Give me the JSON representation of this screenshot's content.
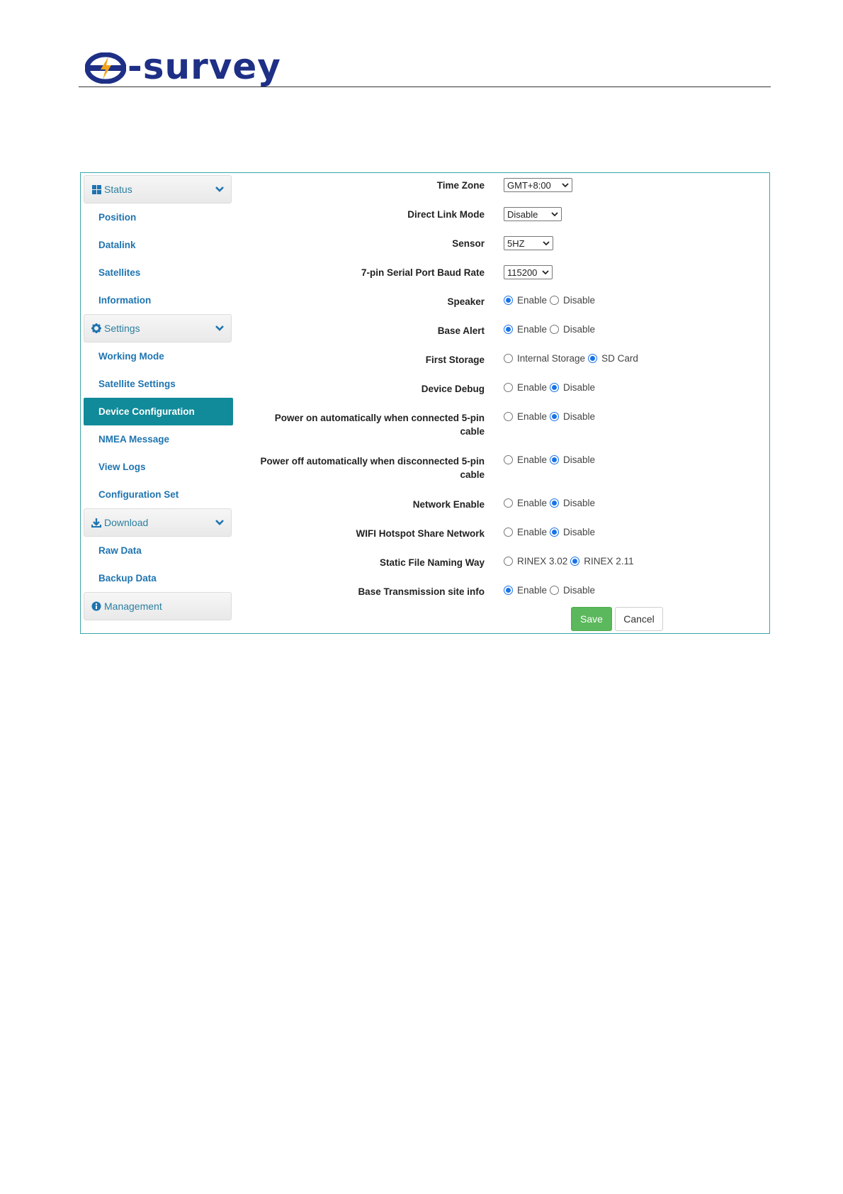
{
  "brand": {
    "name": "-survey",
    "color": "#1e2f86",
    "accent": "#f2a51a"
  },
  "colors": {
    "frame_border": "#3aa6a8",
    "link": "#1f74b0",
    "active_bg": "#118a99",
    "save_green": "#5cb85c",
    "radio_blue": "#1a73e8"
  },
  "sidebar": {
    "status": {
      "label": "Status",
      "icon": "grid-icon",
      "items": [
        "Position",
        "Datalink",
        "Satellites",
        "Information"
      ]
    },
    "settings": {
      "label": "Settings",
      "icon": "gear-icon",
      "items": [
        "Working Mode",
        "Satellite Settings",
        "Device Configuration",
        "NMEA Message",
        "View Logs",
        "Configuration Set"
      ],
      "active": "Device Configuration"
    },
    "download": {
      "label": "Download",
      "icon": "download-icon",
      "items": [
        "Raw Data",
        "Backup Data"
      ]
    },
    "management": {
      "label": "Management",
      "icon": "info-icon"
    }
  },
  "form": {
    "time_zone": {
      "label": "Time Zone",
      "value": "GMT+8:00"
    },
    "direct_link_mode": {
      "label": "Direct Link Mode",
      "value": "Disable"
    },
    "sensor": {
      "label": "Sensor",
      "value": "5HZ"
    },
    "baud_rate": {
      "label": "7-pin Serial Port Baud Rate",
      "value": "115200"
    },
    "speaker": {
      "label": "Speaker",
      "options": [
        "Enable",
        "Disable"
      ],
      "selected": "Enable"
    },
    "base_alert": {
      "label": "Base Alert",
      "options": [
        "Enable",
        "Disable"
      ],
      "selected": "Enable"
    },
    "first_storage": {
      "label": "First Storage",
      "options": [
        "Internal Storage",
        "SD Card"
      ],
      "selected": "SD Card"
    },
    "device_debug": {
      "label": "Device Debug",
      "options": [
        "Enable",
        "Disable"
      ],
      "selected": "Disable"
    },
    "power_on": {
      "label_line1": "Power on automatically when connected 5-pin",
      "label_line2": "cable",
      "options": [
        "Enable",
        "Disable"
      ],
      "selected": "Disable"
    },
    "power_off": {
      "label_line1": "Power off automatically when disconnected 5-pin",
      "label_line2": "cable",
      "options": [
        "Enable",
        "Disable"
      ],
      "selected": "Disable"
    },
    "network_enable": {
      "label": "Network Enable",
      "options": [
        "Enable",
        "Disable"
      ],
      "selected": "Disable"
    },
    "wifi_hotspot": {
      "label": "WIFI Hotspot Share Network",
      "options": [
        "Enable",
        "Disable"
      ],
      "selected": "Disable"
    },
    "static_file_naming": {
      "label": "Static File Naming Way",
      "options": [
        "RINEX 3.02",
        "RINEX 2.11"
      ],
      "selected": "RINEX 2.11"
    },
    "base_transmission": {
      "label": "Base Transmission site info",
      "options": [
        "Enable",
        "Disable"
      ],
      "selected": "Enable"
    }
  },
  "buttons": {
    "save": "Save",
    "cancel": "Cancel"
  }
}
